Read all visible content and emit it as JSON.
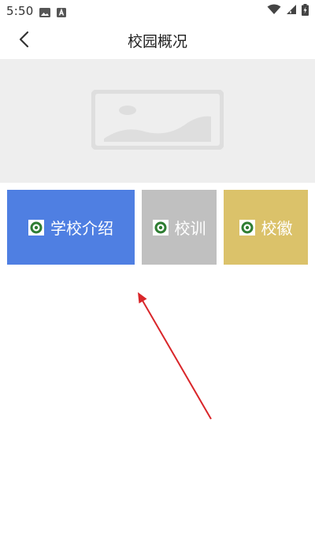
{
  "status_bar": {
    "time": "5:50"
  },
  "header": {
    "title": "校园概况"
  },
  "tiles": [
    {
      "label": "学校介绍",
      "color": "#4f7fe2"
    },
    {
      "label": "校训",
      "color": "#c0c0c0"
    },
    {
      "label": "校徽",
      "color": "#dbc26a"
    }
  ],
  "annotation": {
    "color": "#d9262a"
  }
}
